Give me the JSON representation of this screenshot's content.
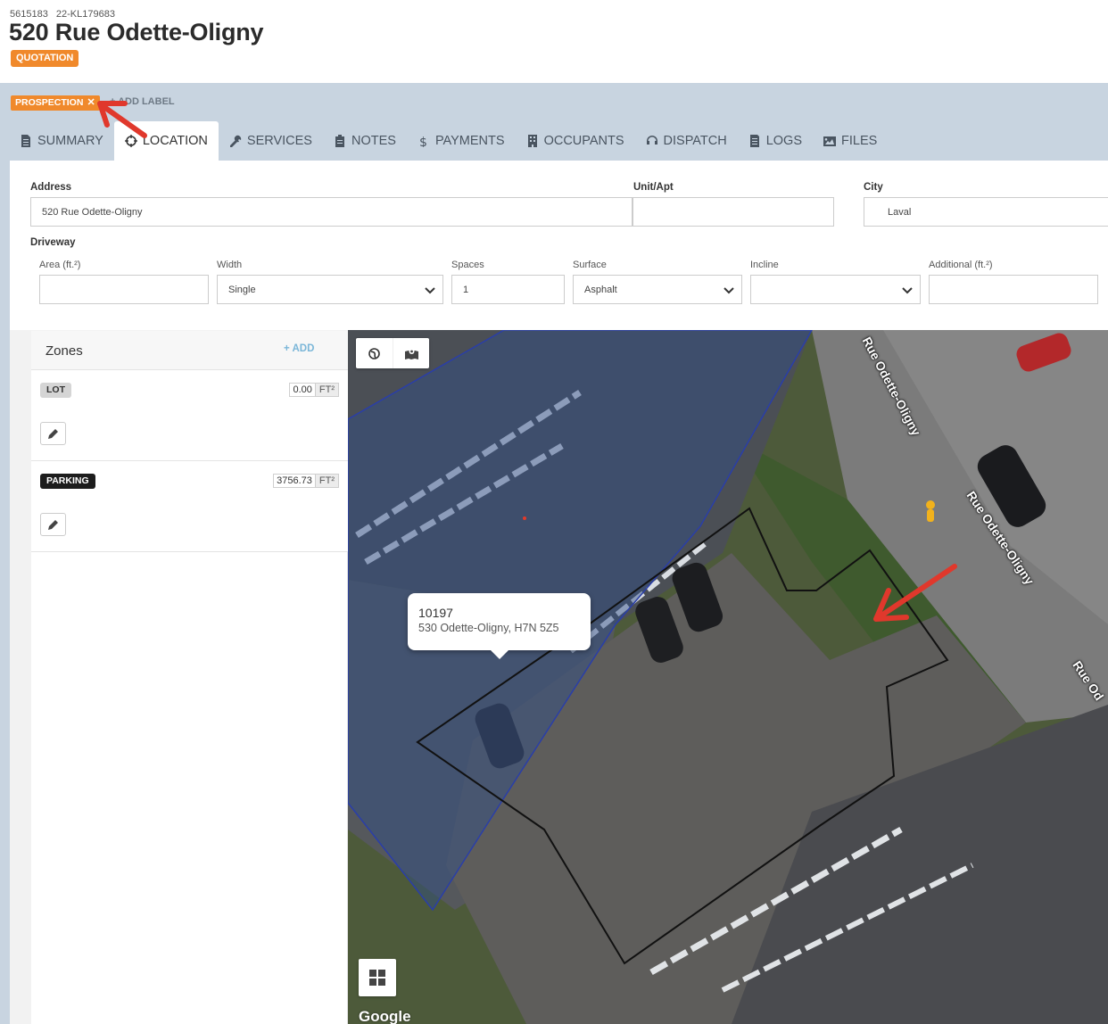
{
  "header": {
    "id_primary": "5615183",
    "id_secondary": "22-KL179683",
    "title": "520 Rue Odette-Oligny",
    "status_badge": "QUOTATION"
  },
  "labels": {
    "chip": "PROSPECTION",
    "chip_remove": "✕",
    "add_label": "+ ADD LABEL"
  },
  "tabs": [
    {
      "label": "SUMMARY",
      "icon": "document-icon"
    },
    {
      "label": "LOCATION",
      "icon": "crosshair-icon",
      "active": true
    },
    {
      "label": "SERVICES",
      "icon": "wrench-icon"
    },
    {
      "label": "NOTES",
      "icon": "clipboard-icon"
    },
    {
      "label": "PAYMENTS",
      "icon": "dollar-icon"
    },
    {
      "label": "OCCUPANTS",
      "icon": "building-icon"
    },
    {
      "label": "DISPATCH",
      "icon": "headset-icon"
    },
    {
      "label": "LOGS",
      "icon": "list-icon"
    },
    {
      "label": "FILES",
      "icon": "image-icon"
    }
  ],
  "address": {
    "address_label": "Address",
    "address_value": "520 Rue Odette-Oligny",
    "unit_label": "Unit/Apt",
    "unit_value": "",
    "city_label": "City",
    "city_value": "Laval"
  },
  "driveway": {
    "section_label": "Driveway",
    "area_label": "Area (ft.²)",
    "area_value": "",
    "width_label": "Width",
    "width_value": "Single",
    "spaces_label": "Spaces",
    "spaces_value": "1",
    "surface_label": "Surface",
    "surface_value": "Asphalt",
    "incline_label": "Incline",
    "incline_value": "",
    "additional_label": "Additional (ft.²)",
    "additional_value": ""
  },
  "zones": {
    "title": "Zones",
    "add_label": "+ ADD",
    "items": [
      {
        "name": "LOT",
        "value": "0.00",
        "unit": "FT²"
      },
      {
        "name": "PARKING",
        "value": "3756.73",
        "unit": "FT²"
      }
    ]
  },
  "map": {
    "street_name": "Rue Odette-Oligny",
    "street_name_short": "Rue Od",
    "popup_number": "10197",
    "popup_address": "530 Odette-Oligny, H7N 5Z5",
    "attribution": "Google"
  }
}
